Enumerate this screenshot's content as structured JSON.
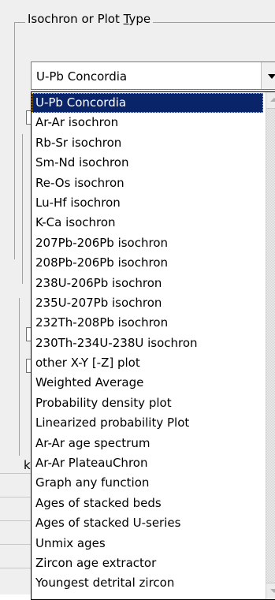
{
  "groupbox": {
    "title_prefix": "Isochron or Plot ",
    "title_underlined": "T",
    "title_suffix": "ype"
  },
  "combo": {
    "selected_value": "U-Pb Concordia"
  },
  "dropdown": {
    "selected_index": 0,
    "items": [
      "U-Pb Concordia",
      "Ar-Ar isochron",
      "Rb-Sr isochron",
      "Sm-Nd isochron",
      "Re-Os isochron",
      "Lu-Hf isochron",
      "K-Ca isochron",
      "207Pb-206Pb isochron",
      "208Pb-206Pb isochron",
      "238U-206Pb isochron",
      "235U-207Pb isochron",
      "232Th-208Pb isochron",
      "230Th-234U-238U isochron",
      "other X-Y [-Z] plot",
      "Weighted Average",
      "Probability density plot",
      "Linearized probability Plot",
      "Ar-Ar age spectrum",
      "Ar-Ar PlateauChron",
      "Graph any function",
      "Ages of stacked beds",
      "Ages of stacked U-series",
      "Unmix ages",
      "Zircon age extractor",
      "Youngest detrital zircon"
    ]
  },
  "background": {
    "partial_label": "k"
  }
}
